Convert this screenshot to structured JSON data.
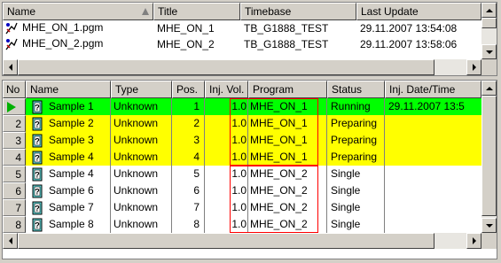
{
  "colors": {
    "running": "#00ff00",
    "preparing": "#ffff00",
    "single": "#ffffff",
    "highlight_box": "#ff0000"
  },
  "programs": {
    "columns": {
      "name": "Name",
      "title": "Title",
      "timebase": "Timebase",
      "last_update": "Last Update"
    },
    "sort_indicator": "ascending",
    "rows": [
      {
        "name": "MHE_ON_1.pgm",
        "title": "MHE_ON_1",
        "timebase": "TB_G1888_TEST",
        "last_update": "29.11.2007 13:54:08",
        "icon": "program-icon"
      },
      {
        "name": "MHE_ON_2.pgm",
        "title": "MHE_ON_2",
        "timebase": "TB_G1888_TEST",
        "last_update": "29.11.2007 13:58:06",
        "icon": "program-icon"
      }
    ]
  },
  "samples": {
    "columns": {
      "no": "No",
      "name": "Name",
      "type": "Type",
      "pos": "Pos.",
      "inj_vol": "Inj. Vol.",
      "program": "Program",
      "status": "Status",
      "inj_date": "Inj. Date/Time"
    },
    "rows": [
      {
        "no": "",
        "current": true,
        "name": "Sample 1",
        "type": "Unknown",
        "pos": "1",
        "inj_vol": "1.0",
        "program": "MHE_ON_1",
        "status": "Running",
        "inj_date": "29.11.2007 13:5",
        "highlight": "running"
      },
      {
        "no": "2",
        "name": "Sample 2",
        "type": "Unknown",
        "pos": "2",
        "inj_vol": "1.0",
        "program": "MHE_ON_1",
        "status": "Preparing",
        "inj_date": "",
        "highlight": "preparing"
      },
      {
        "no": "3",
        "name": "Sample 3",
        "type": "Unknown",
        "pos": "3",
        "inj_vol": "1.0",
        "program": "MHE_ON_1",
        "status": "Preparing",
        "inj_date": "",
        "highlight": "preparing"
      },
      {
        "no": "4",
        "name": "Sample 4",
        "type": "Unknown",
        "pos": "4",
        "inj_vol": "1.0",
        "program": "MHE_ON_1",
        "status": "Preparing",
        "inj_date": "",
        "highlight": "preparing"
      },
      {
        "no": "5",
        "name": "Sample 4",
        "type": "Unknown",
        "pos": "5",
        "inj_vol": "1.0",
        "program": "MHE_ON_2",
        "status": "Single",
        "inj_date": "",
        "highlight": "single"
      },
      {
        "no": "6",
        "name": "Sample 6",
        "type": "Unknown",
        "pos": "6",
        "inj_vol": "1.0",
        "program": "MHE_ON_2",
        "status": "Single",
        "inj_date": "",
        "highlight": "single"
      },
      {
        "no": "7",
        "name": "Sample 7",
        "type": "Unknown",
        "pos": "7",
        "inj_vol": "1.0",
        "program": "MHE_ON_2",
        "status": "Single",
        "inj_date": "",
        "highlight": "single"
      },
      {
        "no": "8",
        "name": "Sample 8",
        "type": "Unknown",
        "pos": "8",
        "inj_vol": "1.0",
        "program": "MHE_ON_2",
        "status": "Single",
        "inj_date": "",
        "highlight": "single"
      }
    ]
  }
}
